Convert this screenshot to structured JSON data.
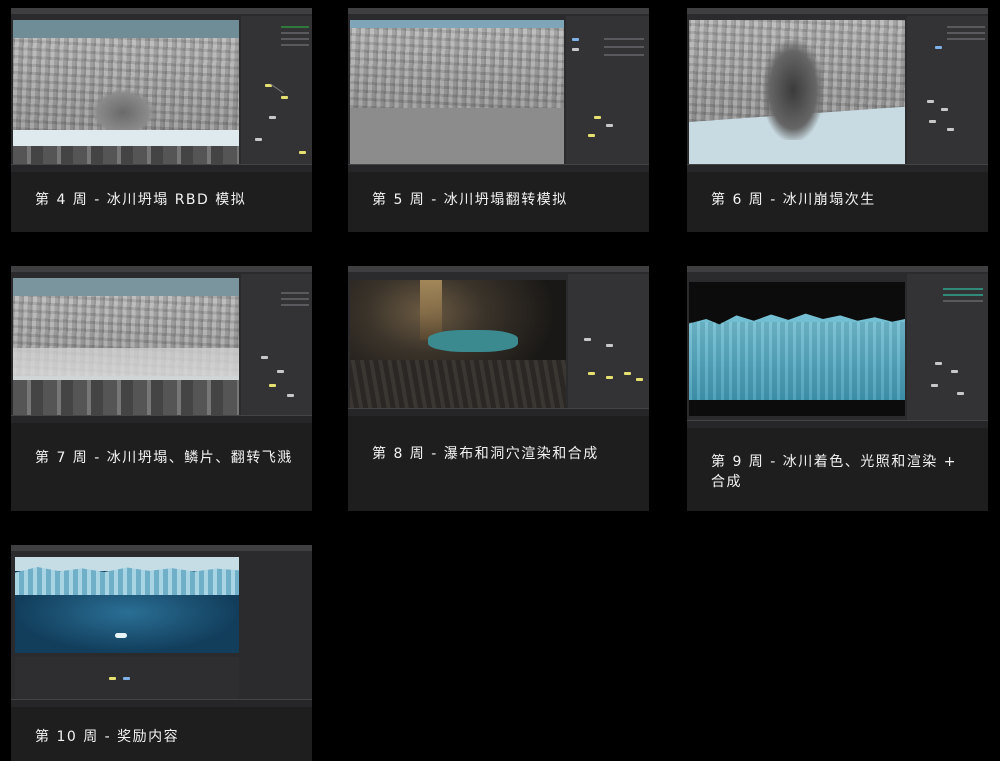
{
  "cards": [
    {
      "caption": "第 4 周 - 冰川坍塌 RBD 模拟"
    },
    {
      "caption": "第 5 周 - 冰川坍塌翻转模拟"
    },
    {
      "caption": "第 6 周 - 冰川崩塌次生"
    },
    {
      "caption": "第 7 周 - 冰川坍塌、鳞片、翻转飞溅"
    },
    {
      "caption": "第 8 周 - 瀑布和洞穴渲染和合成"
    },
    {
      "caption": "第 9 周 - 冰川着色、光照和渲染 + 合成"
    },
    {
      "caption": "第 10 周 - 奖励内容"
    }
  ]
}
